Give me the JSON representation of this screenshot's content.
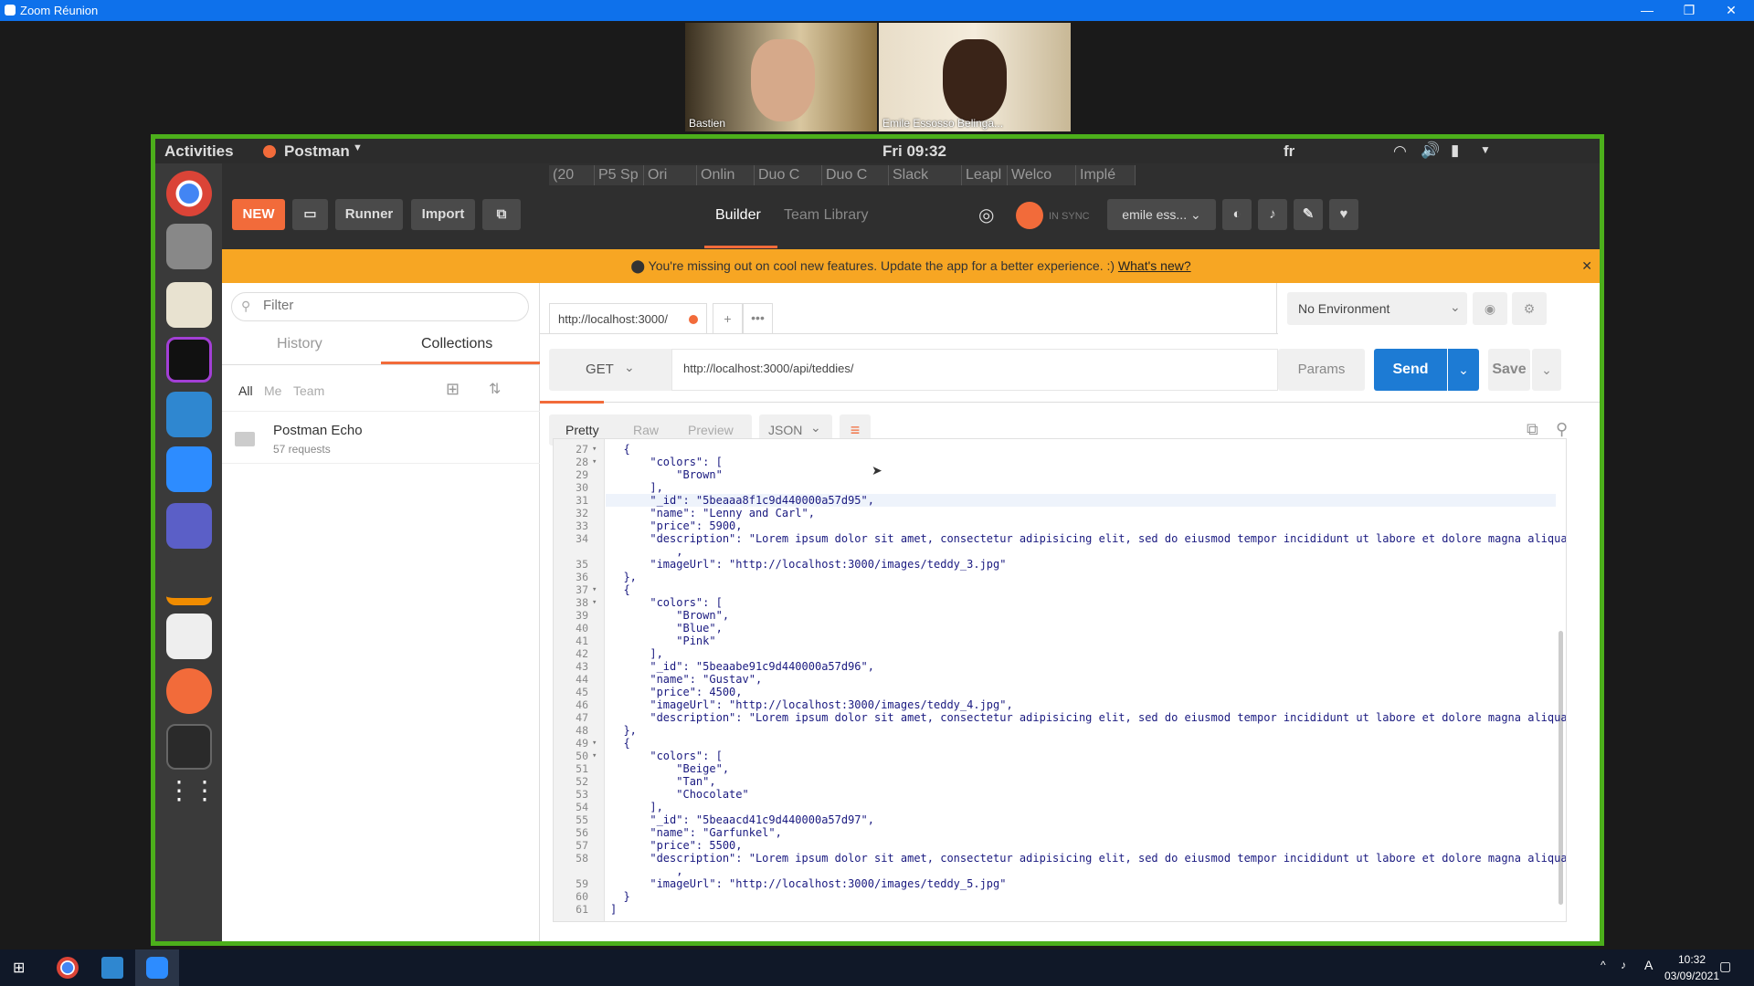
{
  "zoom": {
    "title": "Zoom Réunion",
    "participants": [
      "Bastien",
      "Emile Essosso Belinga..."
    ]
  },
  "ubuntu": {
    "activities": "Activities",
    "app": "Postman",
    "clock": "Fri 09:32",
    "lang": "fr"
  },
  "chrome_tabs": [
    "(20",
    "P5 Sp",
    "Ori",
    "Onlin",
    "Duo C",
    "Duo C",
    "Slack",
    "Leapl",
    "Welco",
    "Implé"
  ],
  "toolbar": {
    "new": "NEW",
    "runner": "Runner",
    "import": "Import",
    "builder": "Builder",
    "team_library": "Team Library",
    "sync": "IN SYNC",
    "user": "emile ess..."
  },
  "banner": {
    "text": "You're missing out on cool new features. Update the app for a better experience. :)",
    "link": "What's new?"
  },
  "sidebar": {
    "filter_placeholder": "Filter",
    "tab_history": "History",
    "tab_collections": "Collections",
    "scope": [
      "All",
      "Me",
      "Team"
    ],
    "collection": {
      "name": "Postman Echo",
      "count": "57 requests"
    }
  },
  "request": {
    "tab_url": "http://localhost:3000/",
    "method": "GET",
    "url": "http://localhost:3000/api/teddies/",
    "params": "Params",
    "send": "Send",
    "save": "Save",
    "environment": "No Environment"
  },
  "response": {
    "view_tabs": [
      "Pretty",
      "Raw",
      "Preview"
    ],
    "format": "JSON"
  },
  "code_lines": [
    {
      "n": "27",
      "f": "▾",
      "t": "  {"
    },
    {
      "n": "28",
      "f": "▾",
      "t": "      \"colors\": ["
    },
    {
      "n": "29",
      "f": "",
      "t": "          \"Brown\""
    },
    {
      "n": "30",
      "f": "",
      "t": "      ],"
    },
    {
      "n": "31",
      "f": "",
      "t": "      \"_id\": \"5beaaa8f1c9d440000a57d95\",",
      "hl": true
    },
    {
      "n": "32",
      "f": "",
      "t": "      \"name\": \"Lenny and Carl\","
    },
    {
      "n": "33",
      "f": "",
      "t": "      \"price\": 5900,"
    },
    {
      "n": "34",
      "f": "",
      "t": "      \"description\": \"Lorem ipsum dolor sit amet, consectetur adipisicing elit, sed do eiusmod tempor incididunt ut labore et dolore magna aliqua.\""
    },
    {
      "n": "",
      "f": "",
      "t": "          ,"
    },
    {
      "n": "35",
      "f": "",
      "t": "      \"imageUrl\": \"http://localhost:3000/images/teddy_3.jpg\""
    },
    {
      "n": "36",
      "f": "",
      "t": "  },"
    },
    {
      "n": "37",
      "f": "▾",
      "t": "  {"
    },
    {
      "n": "38",
      "f": "▾",
      "t": "      \"colors\": ["
    },
    {
      "n": "39",
      "f": "",
      "t": "          \"Brown\","
    },
    {
      "n": "40",
      "f": "",
      "t": "          \"Blue\","
    },
    {
      "n": "41",
      "f": "",
      "t": "          \"Pink\""
    },
    {
      "n": "42",
      "f": "",
      "t": "      ],"
    },
    {
      "n": "43",
      "f": "",
      "t": "      \"_id\": \"5beaabe91c9d440000a57d96\","
    },
    {
      "n": "44",
      "f": "",
      "t": "      \"name\": \"Gustav\","
    },
    {
      "n": "45",
      "f": "",
      "t": "      \"price\": 4500,"
    },
    {
      "n": "46",
      "f": "",
      "t": "      \"imageUrl\": \"http://localhost:3000/images/teddy_4.jpg\","
    },
    {
      "n": "47",
      "f": "",
      "t": "      \"description\": \"Lorem ipsum dolor sit amet, consectetur adipisicing elit, sed do eiusmod tempor incididunt ut labore et dolore magna aliqua.\""
    },
    {
      "n": "48",
      "f": "",
      "t": "  },"
    },
    {
      "n": "49",
      "f": "▾",
      "t": "  {"
    },
    {
      "n": "50",
      "f": "▾",
      "t": "      \"colors\": ["
    },
    {
      "n": "51",
      "f": "",
      "t": "          \"Beige\","
    },
    {
      "n": "52",
      "f": "",
      "t": "          \"Tan\","
    },
    {
      "n": "53",
      "f": "",
      "t": "          \"Chocolate\""
    },
    {
      "n": "54",
      "f": "",
      "t": "      ],"
    },
    {
      "n": "55",
      "f": "",
      "t": "      \"_id\": \"5beaacd41c9d440000a57d97\","
    },
    {
      "n": "56",
      "f": "",
      "t": "      \"name\": \"Garfunkel\","
    },
    {
      "n": "57",
      "f": "",
      "t": "      \"price\": 5500,"
    },
    {
      "n": "58",
      "f": "",
      "t": "      \"description\": \"Lorem ipsum dolor sit amet, consectetur adipisicing elit, sed do eiusmod tempor incididunt ut labore et dolore magna aliqua.\""
    },
    {
      "n": "",
      "f": "",
      "t": "          ,"
    },
    {
      "n": "59",
      "f": "",
      "t": "      \"imageUrl\": \"http://localhost:3000/images/teddy_5.jpg\""
    },
    {
      "n": "60",
      "f": "",
      "t": "  }"
    },
    {
      "n": "61",
      "f": "",
      "t": "]"
    }
  ],
  "taskbar": {
    "time": "10:32",
    "date": "03/09/2021"
  },
  "colors": {
    "zoom_blue": "#0e71eb",
    "share_border": "#4caf1b",
    "postman_orange": "#f26b3a",
    "send_blue": "#1d7bd4",
    "banner": "#f7a623"
  }
}
